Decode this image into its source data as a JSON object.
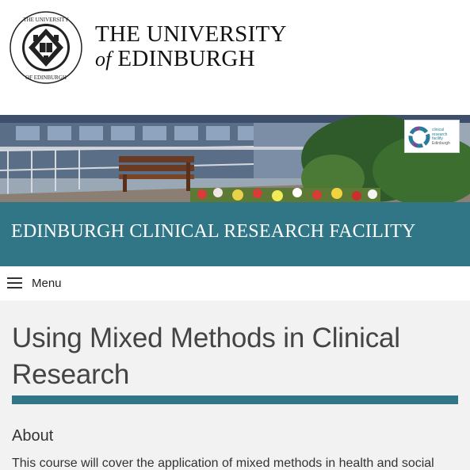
{
  "header": {
    "university_line1": "THE UNIVERSITY",
    "university_of": "of",
    "university_line2": "EDINBURGH",
    "crest_icon": "university-crest"
  },
  "banner": {
    "logo_lines": [
      "clinical",
      "research",
      "facility",
      "Edinburgh"
    ]
  },
  "facility": {
    "title": "EDINBURGH CLINICAL RESEARCH FACILITY"
  },
  "nav": {
    "menu_label": "Menu",
    "menu_icon": "hamburger-icon"
  },
  "content": {
    "page_title": "Using Mixed Methods in Clinical Research",
    "about_heading": "About",
    "about_text": "This course will cover the application of mixed methods in health and social"
  },
  "colors": {
    "brand_teal": "#307686",
    "background_grey": "#f2f2f2"
  }
}
